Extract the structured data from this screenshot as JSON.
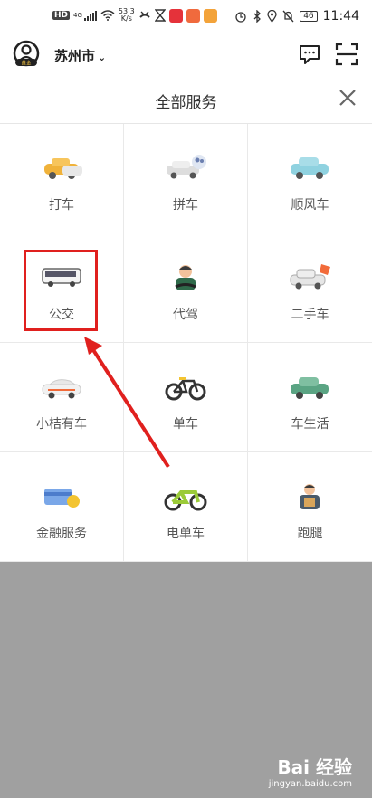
{
  "status_bar": {
    "hd": "HD",
    "net": "4G",
    "speed_value": "53.3",
    "speed_unit": "K/s",
    "battery": "46",
    "time": "11:44"
  },
  "header": {
    "city": "苏州市",
    "badge": "黄金",
    "title": "全部服务"
  },
  "services": [
    {
      "label": "打车",
      "icon": "taxi-icon"
    },
    {
      "label": "拼车",
      "icon": "carpool-icon"
    },
    {
      "label": "顺风车",
      "icon": "hitch-ride-icon"
    },
    {
      "label": "公交",
      "icon": "bus-icon"
    },
    {
      "label": "代驾",
      "icon": "designated-driver-icon"
    },
    {
      "label": "二手车",
      "icon": "used-car-icon"
    },
    {
      "label": "小桔有车",
      "icon": "xiaoju-car-icon"
    },
    {
      "label": "单车",
      "icon": "bicycle-icon"
    },
    {
      "label": "车生活",
      "icon": "car-life-icon"
    },
    {
      "label": "金融服务",
      "icon": "finance-icon"
    },
    {
      "label": "电单车",
      "icon": "ebike-icon"
    },
    {
      "label": "跑腿",
      "icon": "errand-icon"
    }
  ],
  "colors": {
    "highlight": "#e0201e",
    "overlay": "#a0a0a0",
    "text": "#555555"
  },
  "watermark": {
    "brand": "Bai 经验",
    "url": "jingyan.baidu.com"
  }
}
